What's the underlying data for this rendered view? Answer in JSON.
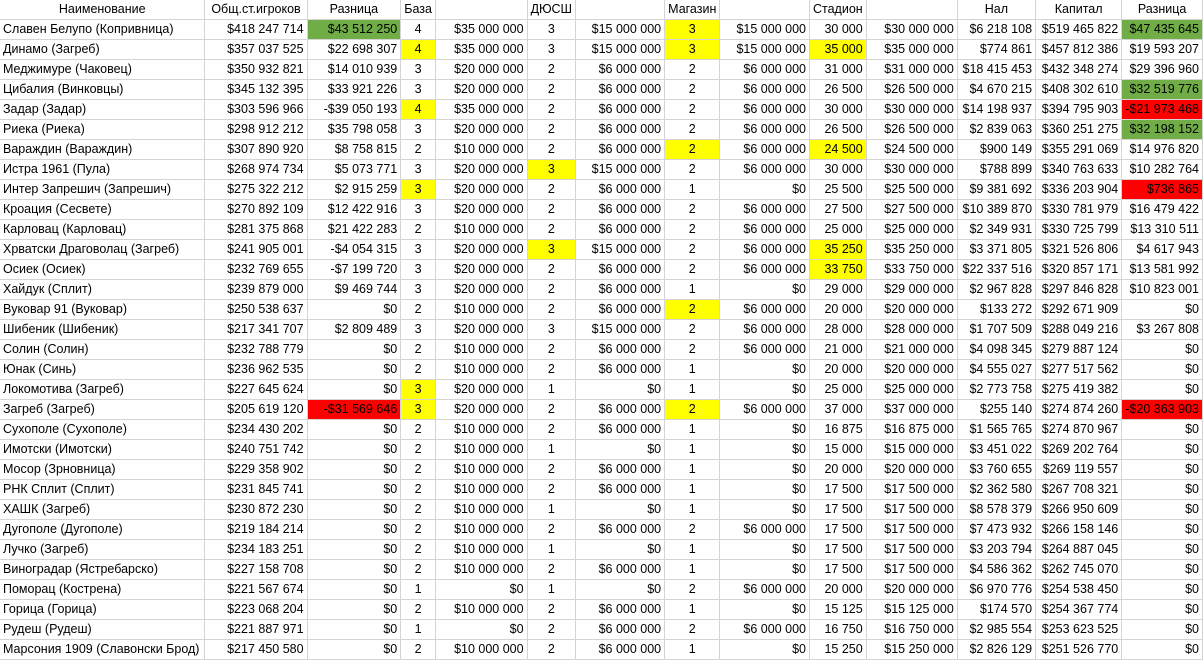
{
  "headers": [
    "Наименование",
    "Общ.ст.игроков",
    "Разница",
    "База",
    "",
    "ДЮСШ",
    "",
    "Магазин",
    "",
    "Стадион",
    "",
    "Нал",
    "Капитал",
    "Разница"
  ],
  "rows": [
    {
      "cells": [
        "Славен Белупо (Копривница)",
        "$418 247 714",
        "$43 512 250",
        "4",
        "$35 000 000",
        "3",
        "$15 000 000",
        "3",
        "$15 000 000",
        "30 000",
        "$30 000 000",
        "$6 218 108",
        "$519 465 822",
        "$47 435 645"
      ],
      "hl": {
        "2": "g",
        "7": "y",
        "13": "g"
      }
    },
    {
      "cells": [
        "Динамо (Загреб)",
        "$357 037 525",
        "$22 698 307",
        "4",
        "$35 000 000",
        "3",
        "$15 000 000",
        "3",
        "$15 000 000",
        "35 000",
        "$35 000 000",
        "$774 861",
        "$457 812 386",
        "$19 593 207"
      ],
      "hl": {
        "3": "y",
        "7": "y",
        "9": "y"
      }
    },
    {
      "cells": [
        "Меджимуре (Чаковец)",
        "$350 932 821",
        "$14 010 939",
        "3",
        "$20 000 000",
        "2",
        "$6 000 000",
        "2",
        "$6 000 000",
        "31 000",
        "$31 000 000",
        "$18 415 453",
        "$432 348 274",
        "$29 396 960"
      ],
      "hl": {}
    },
    {
      "cells": [
        "Цибалия (Винковцы)",
        "$345 132 395",
        "$33 921 226",
        "3",
        "$20 000 000",
        "2",
        "$6 000 000",
        "2",
        "$6 000 000",
        "26 500",
        "$26 500 000",
        "$4 670 215",
        "$408 302 610",
        "$32 519 776"
      ],
      "hl": {
        "13": "g"
      }
    },
    {
      "cells": [
        "Задар (Задар)",
        "$303 596 966",
        "-$39 050 193",
        "4",
        "$35 000 000",
        "2",
        "$6 000 000",
        "2",
        "$6 000 000",
        "30 000",
        "$30 000 000",
        "$14 198 937",
        "$394 795 903",
        "-$21 973 468"
      ],
      "hl": {
        "3": "y",
        "13": "r"
      }
    },
    {
      "cells": [
        "Риека (Риека)",
        "$298 912 212",
        "$35 798 058",
        "3",
        "$20 000 000",
        "2",
        "$6 000 000",
        "2",
        "$6 000 000",
        "26 500",
        "$26 500 000",
        "$2 839 063",
        "$360 251 275",
        "$32 198 152"
      ],
      "hl": {
        "13": "g"
      }
    },
    {
      "cells": [
        "Вараждин (Вараждин)",
        "$307 890 920",
        "$8 758 815",
        "2",
        "$10 000 000",
        "2",
        "$6 000 000",
        "2",
        "$6 000 000",
        "24 500",
        "$24 500 000",
        "$900 149",
        "$355 291 069",
        "$14 976 820"
      ],
      "hl": {
        "7": "y",
        "9": "y"
      }
    },
    {
      "cells": [
        "Истра 1961 (Пула)",
        "$268 974 734",
        "$5 073 771",
        "3",
        "$20 000 000",
        "3",
        "$15 000 000",
        "2",
        "$6 000 000",
        "30 000",
        "$30 000 000",
        "$788 899",
        "$340 763 633",
        "$10 282 764"
      ],
      "hl": {
        "5": "y"
      }
    },
    {
      "cells": [
        "Интер Запрешич (Запрешич)",
        "$275 322 212",
        "$2 915 259",
        "3",
        "$20 000 000",
        "2",
        "$6 000 000",
        "1",
        "$0",
        "25 500",
        "$25 500 000",
        "$9 381 692",
        "$336 203 904",
        "$736 865"
      ],
      "hl": {
        "3": "y",
        "13": "r"
      }
    },
    {
      "cells": [
        "Кроация (Сесвете)",
        "$270 892 109",
        "$12 422 916",
        "3",
        "$20 000 000",
        "2",
        "$6 000 000",
        "2",
        "$6 000 000",
        "27 500",
        "$27 500 000",
        "$10 389 870",
        "$330 781 979",
        "$16 479 422"
      ],
      "hl": {}
    },
    {
      "cells": [
        "Карловац (Карловац)",
        "$281 375 868",
        "$21 422 283",
        "2",
        "$10 000 000",
        "2",
        "$6 000 000",
        "2",
        "$6 000 000",
        "25 000",
        "$25 000 000",
        "$2 349 931",
        "$330 725 799",
        "$13 310 511"
      ],
      "hl": {}
    },
    {
      "cells": [
        "Хрватски Драговолац (Загреб)",
        "$241 905 001",
        "-$4 054 315",
        "3",
        "$20 000 000",
        "3",
        "$15 000 000",
        "2",
        "$6 000 000",
        "35 250",
        "$35 250 000",
        "$3 371 805",
        "$321 526 806",
        "$4 617 943"
      ],
      "hl": {
        "5": "y",
        "9": "y"
      }
    },
    {
      "cells": [
        "Осиек (Осиек)",
        "$232 769 655",
        "-$7 199 720",
        "3",
        "$20 000 000",
        "2",
        "$6 000 000",
        "2",
        "$6 000 000",
        "33 750",
        "$33 750 000",
        "$22 337 516",
        "$320 857 171",
        "$13 581 992"
      ],
      "hl": {
        "9": "y"
      }
    },
    {
      "cells": [
        "Хайдук (Сплит)",
        "$239 879 000",
        "$9 469 744",
        "3",
        "$20 000 000",
        "2",
        "$6 000 000",
        "1",
        "$0",
        "29 000",
        "$29 000 000",
        "$2 967 828",
        "$297 846 828",
        "$10 823 001"
      ],
      "hl": {}
    },
    {
      "cells": [
        "Вуковар 91 (Вуковар)",
        "$250 538 637",
        "$0",
        "2",
        "$10 000 000",
        "2",
        "$6 000 000",
        "2",
        "$6 000 000",
        "20 000",
        "$20 000 000",
        "$133 272",
        "$292 671 909",
        "$0"
      ],
      "hl": {
        "7": "y"
      }
    },
    {
      "cells": [
        "Шибеник (Шибеник)",
        "$217 341 707",
        "$2 809 489",
        "3",
        "$20 000 000",
        "3",
        "$15 000 000",
        "2",
        "$6 000 000",
        "28 000",
        "$28 000 000",
        "$1 707 509",
        "$288 049 216",
        "$3 267 808"
      ],
      "hl": {}
    },
    {
      "cells": [
        "Солин (Солин)",
        "$232 788 779",
        "$0",
        "2",
        "$10 000 000",
        "2",
        "$6 000 000",
        "2",
        "$6 000 000",
        "21 000",
        "$21 000 000",
        "$4 098 345",
        "$279 887 124",
        "$0"
      ],
      "hl": {}
    },
    {
      "cells": [
        "Юнак (Синь)",
        "$236 962 535",
        "$0",
        "2",
        "$10 000 000",
        "2",
        "$6 000 000",
        "1",
        "$0",
        "20 000",
        "$20 000 000",
        "$4 555 027",
        "$277 517 562",
        "$0"
      ],
      "hl": {}
    },
    {
      "cells": [
        "Локомотива (Загреб)",
        "$227 645 624",
        "$0",
        "3",
        "$20 000 000",
        "1",
        "$0",
        "1",
        "$0",
        "25 000",
        "$25 000 000",
        "$2 773 758",
        "$275 419 382",
        "$0"
      ],
      "hl": {
        "3": "y"
      }
    },
    {
      "cells": [
        "Загреб (Загреб)",
        "$205 619 120",
        "-$31 569 646",
        "3",
        "$20 000 000",
        "2",
        "$6 000 000",
        "2",
        "$6 000 000",
        "37 000",
        "$37 000 000",
        "$255 140",
        "$274 874 260",
        "-$20 363 903"
      ],
      "hl": {
        "2": "r",
        "3": "y",
        "7": "y",
        "13": "r"
      }
    },
    {
      "cells": [
        "Сухополе (Сухополе)",
        "$234 430 202",
        "$0",
        "2",
        "$10 000 000",
        "2",
        "$6 000 000",
        "1",
        "$0",
        "16 875",
        "$16 875 000",
        "$1 565 765",
        "$274 870 967",
        "$0"
      ],
      "hl": {}
    },
    {
      "cells": [
        "Имотски (Имотски)",
        "$240 751 742",
        "$0",
        "2",
        "$10 000 000",
        "1",
        "$0",
        "1",
        "$0",
        "15 000",
        "$15 000 000",
        "$3 451 022",
        "$269 202 764",
        "$0"
      ],
      "hl": {}
    },
    {
      "cells": [
        "Мосор (Зрновница)",
        "$229 358 902",
        "$0",
        "2",
        "$10 000 000",
        "2",
        "$6 000 000",
        "1",
        "$0",
        "20 000",
        "$20 000 000",
        "$3 760 655",
        "$269 119 557",
        "$0"
      ],
      "hl": {}
    },
    {
      "cells": [
        "РНК Сплит (Сплит)",
        "$231 845 741",
        "$0",
        "2",
        "$10 000 000",
        "2",
        "$6 000 000",
        "1",
        "$0",
        "17 500",
        "$17 500 000",
        "$2 362 580",
        "$267 708 321",
        "$0"
      ],
      "hl": {}
    },
    {
      "cells": [
        "ХАШК (Загреб)",
        "$230 872 230",
        "$0",
        "2",
        "$10 000 000",
        "1",
        "$0",
        "1",
        "$0",
        "17 500",
        "$17 500 000",
        "$8 578 379",
        "$266 950 609",
        "$0"
      ],
      "hl": {}
    },
    {
      "cells": [
        "Дугополе (Дугополе)",
        "$219 184 214",
        "$0",
        "2",
        "$10 000 000",
        "2",
        "$6 000 000",
        "2",
        "$6 000 000",
        "17 500",
        "$17 500 000",
        "$7 473 932",
        "$266 158 146",
        "$0"
      ],
      "hl": {}
    },
    {
      "cells": [
        "Лучко (Загреб)",
        "$234 183 251",
        "$0",
        "2",
        "$10 000 000",
        "1",
        "$0",
        "1",
        "$0",
        "17 500",
        "$17 500 000",
        "$3 203 794",
        "$264 887 045",
        "$0"
      ],
      "hl": {}
    },
    {
      "cells": [
        "Виноградар (Ястребарско)",
        "$227 158 708",
        "$0",
        "2",
        "$10 000 000",
        "2",
        "$6 000 000",
        "1",
        "$0",
        "17 500",
        "$17 500 000",
        "$4 586 362",
        "$262 745 070",
        "$0"
      ],
      "hl": {}
    },
    {
      "cells": [
        "Поморац (Кострена)",
        "$221 567 674",
        "$0",
        "1",
        "$0",
        "1",
        "$0",
        "2",
        "$6 000 000",
        "20 000",
        "$20 000 000",
        "$6 970 776",
        "$254 538 450",
        "$0"
      ],
      "hl": {}
    },
    {
      "cells": [
        "Горица (Горица)",
        "$223 068 204",
        "$0",
        "2",
        "$10 000 000",
        "2",
        "$6 000 000",
        "1",
        "$0",
        "15 125",
        "$15 125 000",
        "$174 570",
        "$254 367 774",
        "$0"
      ],
      "hl": {}
    },
    {
      "cells": [
        "Рудеш (Рудеш)",
        "$221 887 971",
        "$0",
        "1",
        "$0",
        "2",
        "$6 000 000",
        "2",
        "$6 000 000",
        "16 750",
        "$16 750 000",
        "$2 985 554",
        "$253 623 525",
        "$0"
      ],
      "hl": {}
    },
    {
      "cells": [
        "Марсония 1909 (Славонски Брод)",
        "$217 450 580",
        "$0",
        "2",
        "$10 000 000",
        "2",
        "$6 000 000",
        "1",
        "$0",
        "15 250",
        "$15 250 000",
        "$2 826 129",
        "$251 526 770",
        "$0"
      ],
      "hl": {}
    }
  ]
}
